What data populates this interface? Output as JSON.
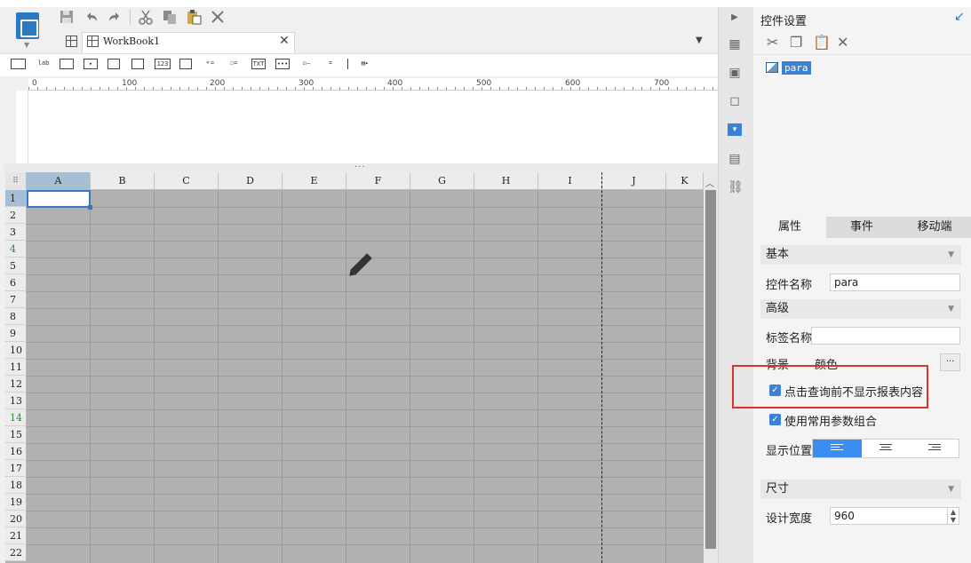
{
  "toolbar": {
    "icons": [
      "save-icon",
      "undo-icon",
      "redo-icon",
      "cut-icon",
      "copy-icon",
      "paste-icon",
      "delete-icon"
    ]
  },
  "tab": {
    "label": "WorkBook1",
    "close": "✕"
  },
  "ruler": {
    "labels": [
      "0",
      "100",
      "200",
      "300",
      "400",
      "500",
      "600",
      "700"
    ]
  },
  "sheet": {
    "columns": [
      "A",
      "B",
      "C",
      "D",
      "E",
      "F",
      "G",
      "H",
      "I",
      "J",
      "K"
    ],
    "rows": [
      "1",
      "2",
      "3",
      "4",
      "5",
      "6",
      "7",
      "8",
      "9",
      "10",
      "11",
      "12",
      "13",
      "14",
      "15",
      "16",
      "17",
      "18",
      "19",
      "20",
      "21",
      "22"
    ]
  },
  "panel": {
    "title": "控件设置",
    "tree_item": "para",
    "tabs": [
      "属性",
      "事件",
      "移动端"
    ],
    "sections": {
      "basic": "基本",
      "advanced": "高级",
      "size": "尺寸"
    },
    "fields": {
      "name_label": "控件名称",
      "name_value": "para",
      "tag_label": "标签名称",
      "tag_value": "",
      "bg_label": "背景",
      "bg_value": "颜色",
      "bg_more": "···",
      "position_label": "显示位置",
      "width_label": "设计宽度",
      "width_value": "960"
    },
    "checkboxes": {
      "hide_before_query": "点击查询前不显示报表内容",
      "use_common_params": "使用常用参数组合"
    }
  },
  "colors": {
    "accent": "#3b82d6",
    "highlight": "#e0312d",
    "sheet_bg": "#b1b1b1"
  }
}
